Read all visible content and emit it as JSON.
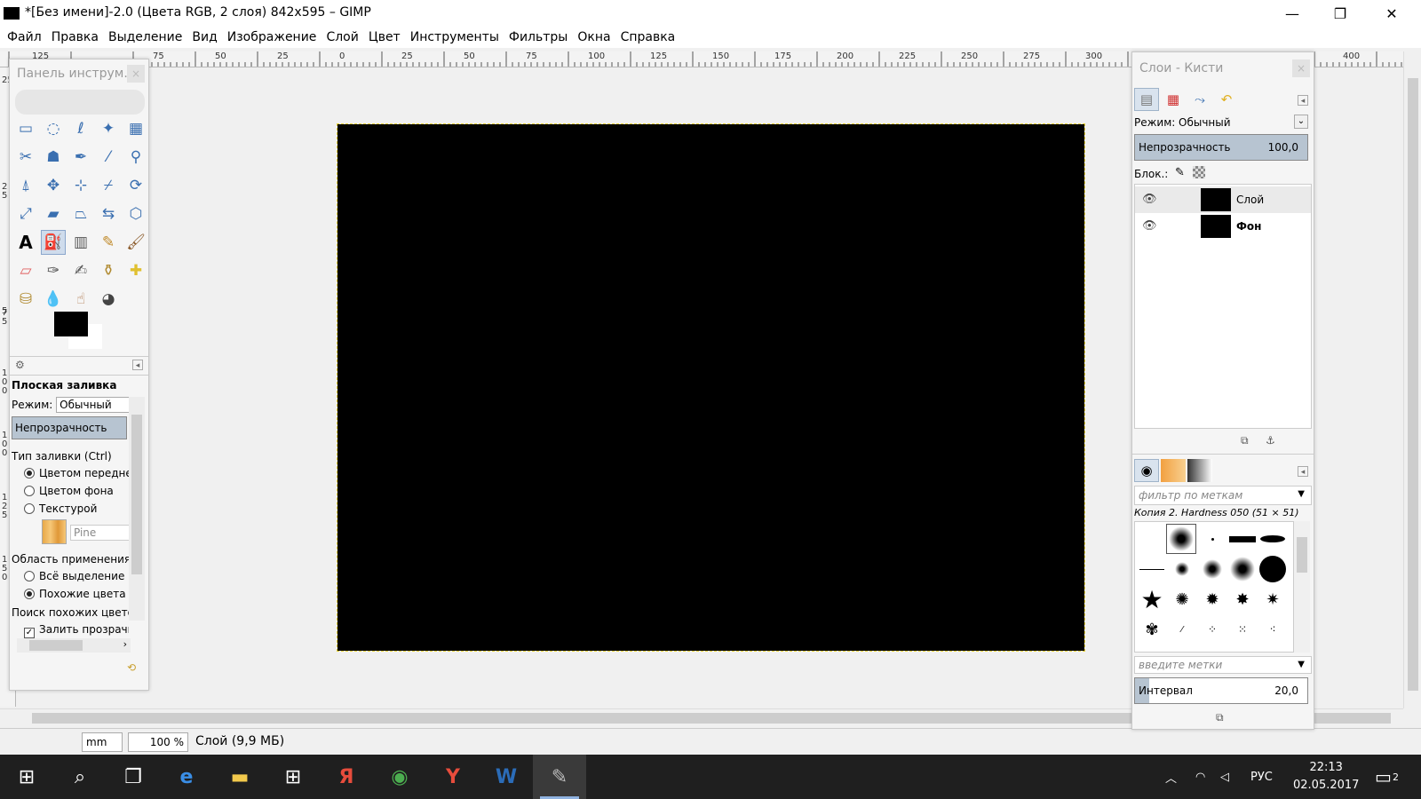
{
  "window": {
    "title": "*[Без имени]-2.0 (Цвета RGB, 2 слоя) 842x595 – GIMP",
    "minimize": "—",
    "maximize": "❐",
    "close": "✕"
  },
  "menu": [
    "Файл",
    "Правка",
    "Выделение",
    "Вид",
    "Изображение",
    "Слой",
    "Цвет",
    "Инструменты",
    "Фильтры",
    "Окна",
    "Справка"
  ],
  "ruler": {
    "h_labels": [
      "125",
      "75",
      "50",
      "25",
      "0",
      "25",
      "50",
      "75",
      "100",
      "125",
      "150",
      "175",
      "200",
      "225",
      "250",
      "275",
      "300",
      "400"
    ],
    "v_labels": [
      "25",
      "2",
      "5",
      "1",
      "0",
      "0",
      "5",
      "7",
      "5",
      "1",
      "0",
      "0",
      "1",
      "2",
      "5",
      "1",
      "5",
      "0"
    ]
  },
  "toolbox": {
    "title": "Панель инструм...",
    "close": "×",
    "selected_tool": "bucket-fill",
    "options_title": "Плоская заливка",
    "mode_label": "Режим:",
    "mode_value": "Обычный",
    "opacity_label": "Непрозрачность",
    "fill_type_label": "Тип заливки (Ctrl)",
    "fill_fg": "Цветом переднег",
    "fill_bg": "Цветом фона",
    "fill_pattern": "Текстурой",
    "pattern_name": "Pine",
    "area_label": "Область применения (S",
    "area_all": "Всё выделение",
    "area_similar": "Похожие цвета",
    "similar_label": "Поиск похожих цветов",
    "fill_transparent": "Залить прозрачн",
    "fill_selection_choice": "similar"
  },
  "dock": {
    "title": "Слои - Кисти",
    "close": "×",
    "mode_label": "Режим:",
    "mode_value": "Обычный",
    "opacity_label": "Непрозрачность",
    "opacity_value": "100,0",
    "lock_label": "Блок.:",
    "layers": [
      {
        "name": "Слой",
        "bold": false
      },
      {
        "name": "Фон",
        "bold": true
      }
    ],
    "brush_filter_placeholder": "фильтр по меткам",
    "brush_name": "Копия 2. Hardness 050 (51 × 51)",
    "tags_placeholder": "введите метки",
    "spacing_label": "Интервал",
    "spacing_value": "20,0"
  },
  "status": {
    "unit": "mm",
    "zoom": "100 %",
    "info": "Слой (9,9 МБ)"
  },
  "taskbar": {
    "language": "РУС",
    "time": "22:13",
    "date": "02.05.2017",
    "notifications": "2"
  }
}
